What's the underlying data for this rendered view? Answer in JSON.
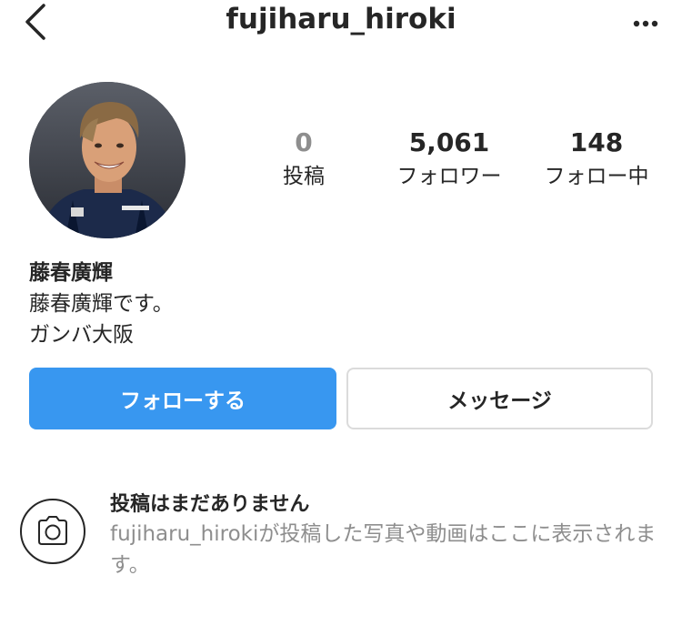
{
  "header": {
    "back_icon": "chevron-left-icon",
    "username": "fujiharu_hiroki",
    "more_icon": "ellipsis-horizontal-icon"
  },
  "stats": {
    "posts": {
      "value": "0",
      "label": "投稿"
    },
    "followers": {
      "value": "5,061",
      "label": "フォロワー"
    },
    "following": {
      "value": "148",
      "label": "フォロー中"
    }
  },
  "profile": {
    "display_name": "藤春廣輝",
    "bio_lines": [
      "藤春廣輝です。",
      "ガンバ大阪"
    ]
  },
  "actions": {
    "follow_label": "フォローする",
    "message_label": "メッセージ"
  },
  "empty_state": {
    "icon": "camera-icon",
    "title": "投稿はまだありません",
    "description": "fujiharu_hirokiが投稿した写真や動画はここに表示されます。"
  },
  "colors": {
    "primary_blue": "#3897f0",
    "text": "#262626",
    "secondary_text": "#8e8e8e",
    "border": "#dbdbdb"
  }
}
